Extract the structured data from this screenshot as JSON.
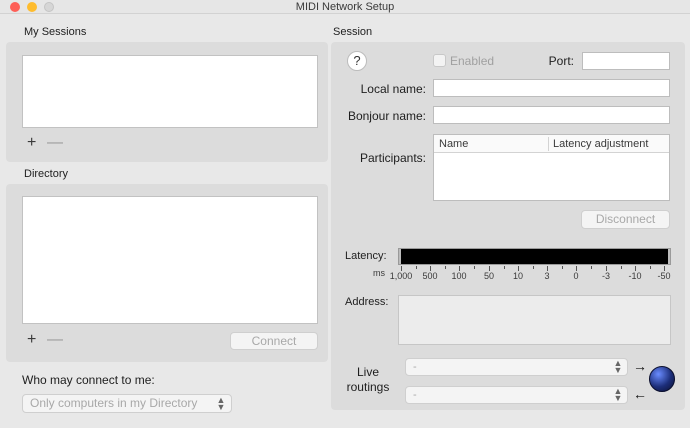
{
  "window": {
    "title": "MIDI Network Setup"
  },
  "my_sessions": {
    "label": "My Sessions",
    "add_symbol": "+",
    "remove_symbol": "—"
  },
  "directory": {
    "label": "Directory",
    "add_symbol": "+",
    "remove_symbol": "—",
    "connect_label": "Connect"
  },
  "access": {
    "label": "Who may connect to me:",
    "value": "Only computers in my Directory"
  },
  "session": {
    "label": "Session",
    "help_symbol": "?",
    "enabled_label": "Enabled",
    "port_label": "Port:",
    "local_name_label": "Local name:",
    "bonjour_name_label": "Bonjour name:",
    "participants_label": "Participants:",
    "participants_columns": [
      "Name",
      "Latency adjustment"
    ],
    "disconnect_label": "Disconnect",
    "latency_label": "Latency:",
    "latency_unit": "ms",
    "latency_ticks": [
      "1,000",
      "500",
      "100",
      "50",
      "10",
      "3",
      "0",
      "-3",
      "-10",
      "-50"
    ],
    "address_label": "Address:",
    "live_routings_label_line1": "Live",
    "live_routings_label_line2": "routings",
    "routing_in_value": "-",
    "routing_out_value": "-",
    "arrow_right": "→",
    "arrow_left": "←"
  },
  "colors": {
    "close": "#fe5f57",
    "minimize": "#febc2e",
    "zoom": "#d6d6d6",
    "meter": "#000000"
  },
  "icons": {
    "globe": "network-globe-icon"
  }
}
